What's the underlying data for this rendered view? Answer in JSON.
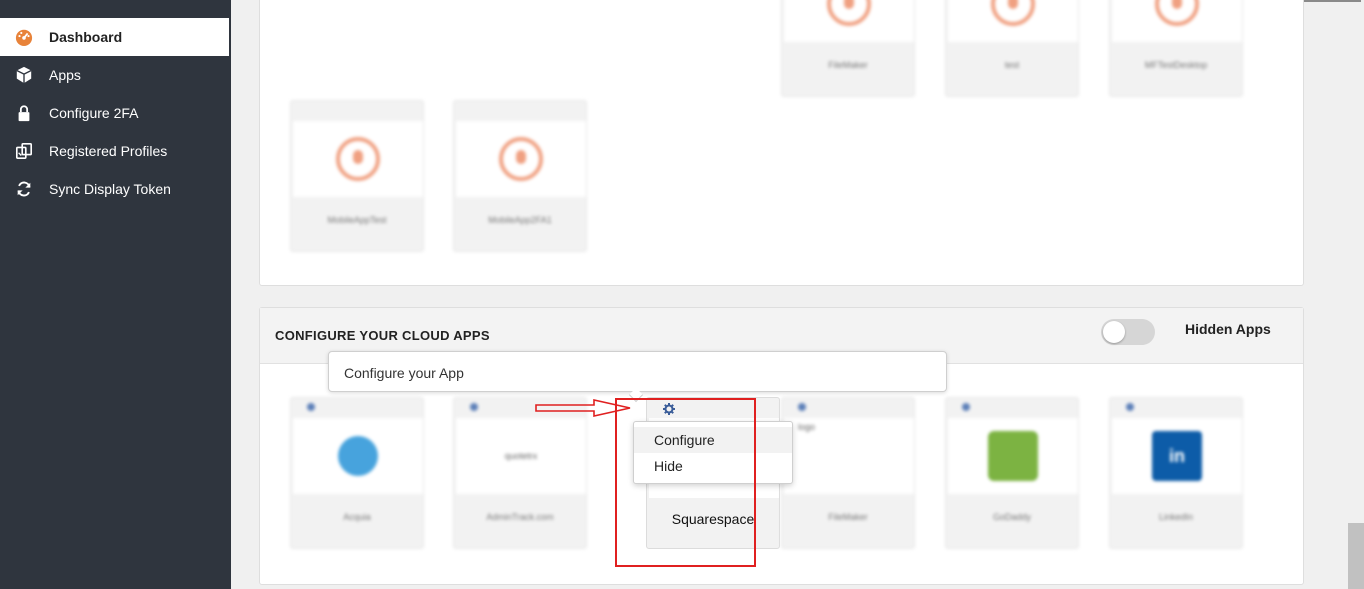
{
  "sidebar": {
    "items": [
      {
        "label": "Dashboard",
        "icon": "dashboard-icon",
        "active": true
      },
      {
        "label": "Apps",
        "icon": "box-icon",
        "active": false
      },
      {
        "label": "Configure 2FA",
        "icon": "lock-icon",
        "active": false
      },
      {
        "label": "Registered Profiles",
        "icon": "profiles-icon",
        "active": false
      },
      {
        "label": "Sync Display Token",
        "icon": "sync-icon",
        "active": false
      }
    ]
  },
  "top_panel": {
    "row1": [
      "FileMaker",
      "test",
      "MFTestDesktop"
    ],
    "row2": [
      "MobileAppTest",
      "MobileApp2FA1"
    ]
  },
  "cloud_panel": {
    "title": "CONFIGURE YOUR CLOUD APPS",
    "toggle_label": "Hidden Apps",
    "toggle_on": false,
    "tooltip": "Configure your App",
    "apps": [
      {
        "name": "Acquia",
        "logo": "drop-logo"
      },
      {
        "name": "AdminTrack.com",
        "logo": "text-logo",
        "logo_text": "quotetrx"
      },
      {
        "name": "Squarespace",
        "logo": "none"
      },
      {
        "name": "FileMaker",
        "logo": "broken-image",
        "logo_text": "logo"
      },
      {
        "name": "GoDaddy",
        "logo": "android-logo"
      },
      {
        "name": "LinkedIn",
        "logo": "linkedin-logo",
        "logo_text": "in"
      }
    ],
    "menu": {
      "items": [
        "Configure",
        "Hide"
      ]
    }
  },
  "colors": {
    "sidebar_bg": "#2f353e",
    "accent_orange": "#e8833a",
    "annotation_red": "#e02020",
    "gear_blue": "#3a5d99"
  }
}
